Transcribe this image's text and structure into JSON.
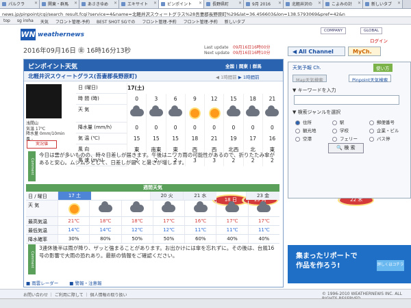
{
  "browser": {
    "tabs": [
      "パルクラ",
      "関東・群馬",
      "あさきゆめ",
      "エキサイト",
      "ピンポイント",
      "長野県町",
      "9月 2016",
      "北軽井沢の",
      "こよみの計",
      "新しいタブ"
    ],
    "active_tab_index": 4,
    "address": "news.jp/pinpoint/cgi/search_result.fcgi?service=4&name=北軽井沢スウィートグラス%28吾妻郡長野原町%29&lat=36.456603&lon=138.5793069&pref=42&n",
    "bookmarks": [
      "top",
      "sg iroha",
      "天気",
      "フロント管理-予約",
      "BEST SHOT SGでの",
      "フロント管理-予約",
      "フロント管理-予約",
      "新しいタブ"
    ]
  },
  "site": {
    "logo_mark": "WN",
    "logo_text": "weathernews",
    "company_link": "COMPANY",
    "global_link": "GLOBAL",
    "login_link": "ログイン",
    "date_line": "2016年09月16日 ㊎ 16時16分13秒",
    "last_update_label": "Last update",
    "last_update_value": "09月16日16時00分",
    "next_update_label": "Next update",
    "next_update_value": "09月16日16時10分"
  },
  "pinpoint": {
    "title": "ピンポイント天気",
    "breadcrumb": "全国 | 関東 | 群馬",
    "location": "北軽井沢スウィートグラス(吾妻郡長野原町)",
    "prev_hour": "1時間前",
    "next_hour": "1時間前",
    "camera_info": [
      "浅間山",
      "気温 17℃",
      "降水量 0mm/10min",
      "風 -"
    ],
    "live_badge": "実況値",
    "row_labels": [
      "日 (曜日)",
      "時 間 (時)",
      "天 気",
      "降水量 (mm/h)",
      "気 温 (℃)",
      "風 向",
      "風 速 (m/s)"
    ],
    "day": "17(土)",
    "hours": [
      "0",
      "3",
      "6",
      "9",
      "12",
      "15",
      "18",
      "21"
    ],
    "weather": [
      "cloud",
      "cloud",
      "cloud",
      "sun",
      "sun",
      "cloud",
      "cloud",
      "cloud"
    ],
    "precip": [
      "0",
      "0",
      "0",
      "0",
      "0",
      "0",
      "0",
      "0"
    ],
    "temp": [
      "15",
      "15",
      "15",
      "18",
      "21",
      "19",
      "17",
      "16"
    ],
    "wind_dir": [
      "東",
      "南東",
      "東",
      "西",
      "西",
      "北西",
      "北",
      "東"
    ],
    "wind_speed": [
      "2",
      "2",
      "2",
      "3",
      "3",
      "2",
      "2",
      "2"
    ],
    "comment_badge": "Comment",
    "comment": "今日は雲が多いものの、時々日差しが届きます。午後はニワカ雨の可能性があるので、折りたたみ傘があると安心。ムシムシとして、日差しが届くと暑さが増します。"
  },
  "weekly": {
    "title": "週間天気",
    "labels": [
      "日 / 曜日",
      "天 気",
      "最高気温",
      "最低気温",
      "降水確率"
    ],
    "days": [
      "17 土",
      "18 日",
      "19 月",
      "20 火",
      "21 水",
      "22 木",
      "23 金"
    ],
    "day_types": [
      "sat",
      "sun",
      "sun",
      "wk",
      "wk",
      "sun",
      "wk"
    ],
    "high": [
      "21℃",
      "18℃",
      "18℃",
      "17℃",
      "16℃",
      "17℃",
      "17℃"
    ],
    "low": [
      "14℃",
      "14℃",
      "12℃",
      "12℃",
      "11℃",
      "11℃",
      "11℃"
    ],
    "rain": [
      "30%",
      "80%",
      "50%",
      "50%",
      "60%",
      "40%",
      "40%"
    ],
    "comment": "3連休後半は雨が降り、ザッと強まることがあります。お出かけには傘を忘れずに。その後は、台風16号の影響で大雨の恐れあり。最新の情報をご確認ください。",
    "link_radar": "雨雲レーダー",
    "link_warning": "警報・注意報"
  },
  "sidebar": {
    "all_channel": "All Channel",
    "mych": "MyCh.",
    "usage": "使い方",
    "box_title": "天気予報 Ch.",
    "tab_map": "Map天気検索",
    "tab_pinpoint": "Pinpoint天気検索",
    "keyword_label": "キーワードを入力",
    "genre_label": "検索ジャンルを選択",
    "genres": [
      "住所",
      "駅",
      "郵便番号",
      "観光地",
      "学校",
      "企業・ビル",
      "空港",
      "フェリー",
      "バス停"
    ],
    "search_button": "検 索",
    "ad_line1": "集まったリポートで",
    "ad_line2": "作品を作ろう!",
    "ad_btn": "詳しくはコチラ"
  },
  "footer": {
    "links": "お問い合わせ ｜ ご利用に際して ｜ 個人情報の取り扱い",
    "copyright": "© 1996-2010 WEATHERNEWS INC. ALL RIGHTS RESERVED."
  }
}
